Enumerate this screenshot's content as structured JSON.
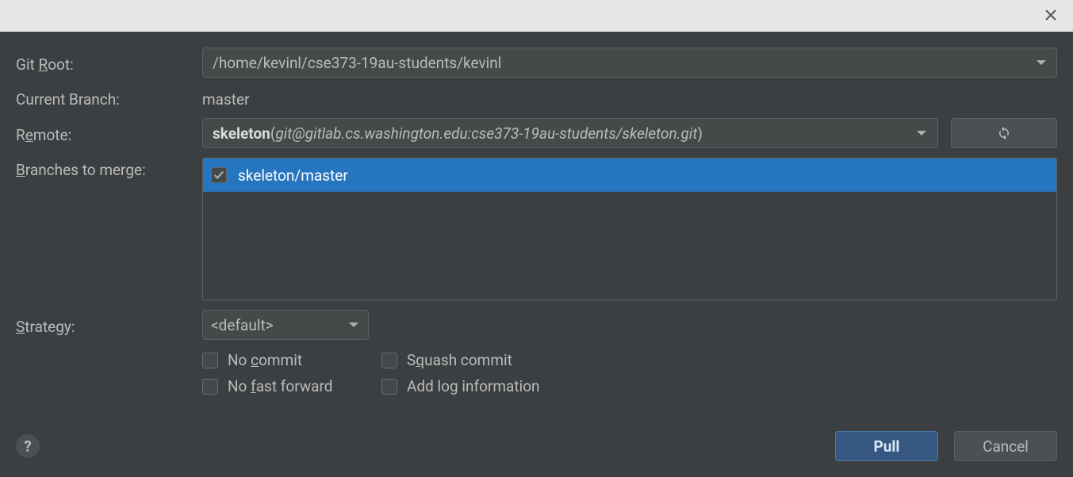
{
  "titlebar": {},
  "labels": {
    "git_root_before": "Git ",
    "git_root_letter": "R",
    "git_root_after": "oot:",
    "current_branch": "Current Branch:",
    "remote_before": "R",
    "remote_letter": "e",
    "remote_after": "mote:",
    "branches_before": "",
    "branches_letter": "B",
    "branches_after": "ranches to merge:",
    "strategy_before": "",
    "strategy_letter": "S",
    "strategy_after": "trategy:"
  },
  "git_root": {
    "value": "/home/kevinl/cse373-19au-students/kevinl"
  },
  "current_branch": {
    "value": "master"
  },
  "remote": {
    "name": "skeleton",
    "paren_open": "(",
    "url": "git@gitlab.cs.washington.edu:cse373-19au-students/skeleton.git",
    "paren_close": ")"
  },
  "branches": {
    "items": [
      {
        "label": "skeleton/master",
        "checked": true
      }
    ]
  },
  "strategy": {
    "value": "<default>"
  },
  "options": {
    "no_commit_before": "No ",
    "no_commit_letter": "c",
    "no_commit_after": "ommit",
    "squash_before": "S",
    "squash_letter": "q",
    "squash_after": "uash commit",
    "no_ff_before": "No ",
    "no_ff_letter": "f",
    "no_ff_after": "ast forward",
    "add_log_before": "Add lo",
    "add_log_letter": "g",
    "add_log_after": " information"
  },
  "footer": {
    "help": "?",
    "pull": "Pull",
    "cancel": "Cancel"
  }
}
